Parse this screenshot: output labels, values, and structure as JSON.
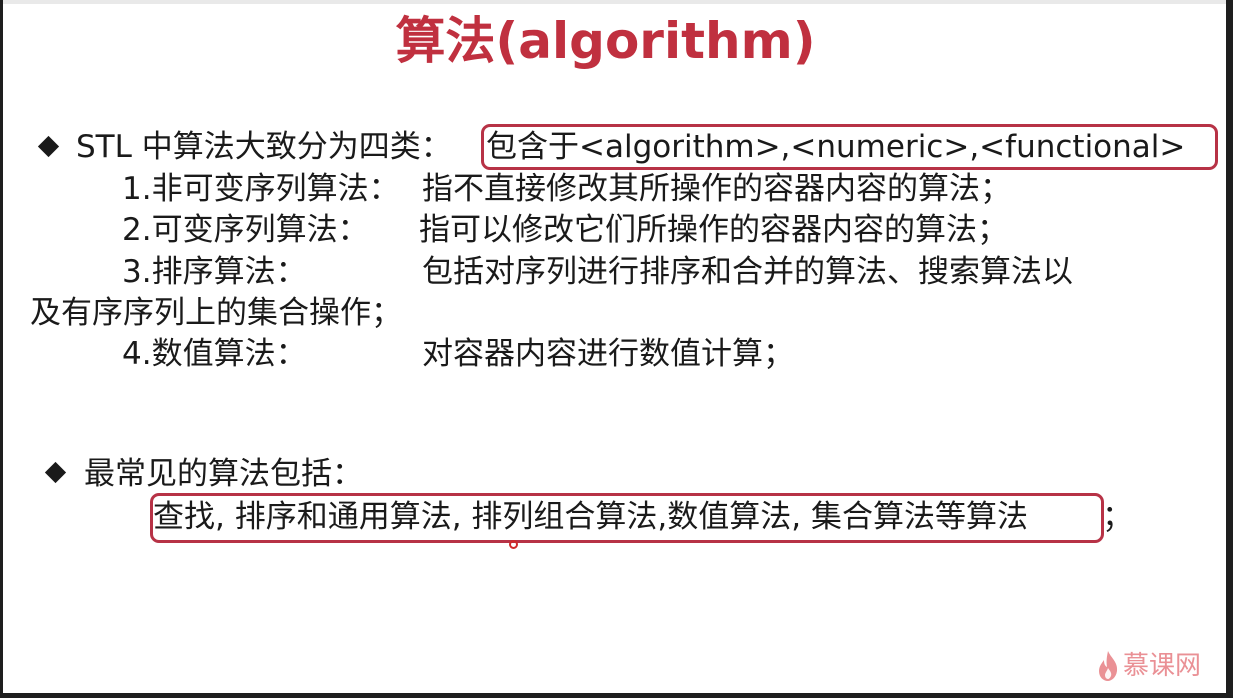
{
  "slide": {
    "title": "算法(algorithm)",
    "section1": {
      "bullet_text": "STL 中算法大致分为四类：",
      "highlight_text": "包含于<algorithm>,<numeric>,<functional>",
      "items": [
        {
          "label": "1.非可变序列算法：",
          "description": "指不直接修改其所操作的容器内容的算法；"
        },
        {
          "label": "2.可变序列算法：",
          "description": "指可以修改它们所操作的容器内容的算法；"
        },
        {
          "label": "3.排序算法：",
          "description": "包括对序列进行排序和合并的算法、搜索算法以",
          "continuation": "及有序序列上的集合操作；"
        },
        {
          "label": "4.数值算法：",
          "description": "对容器内容进行数值计算；"
        }
      ]
    },
    "section2": {
      "bullet_text": "最常见的算法包括：",
      "highlight_text": "查找, 排序和通用算法, 排列组合算法,数值算法, 集合算法等算法",
      "trailing": "；"
    }
  },
  "watermark": {
    "text": "慕课网"
  },
  "colors": {
    "title": "#c0303f",
    "highlight_border": "#b73246",
    "body_text": "#1a1a1a",
    "cursor": "#d02a2a",
    "watermark": "#e36c72"
  }
}
